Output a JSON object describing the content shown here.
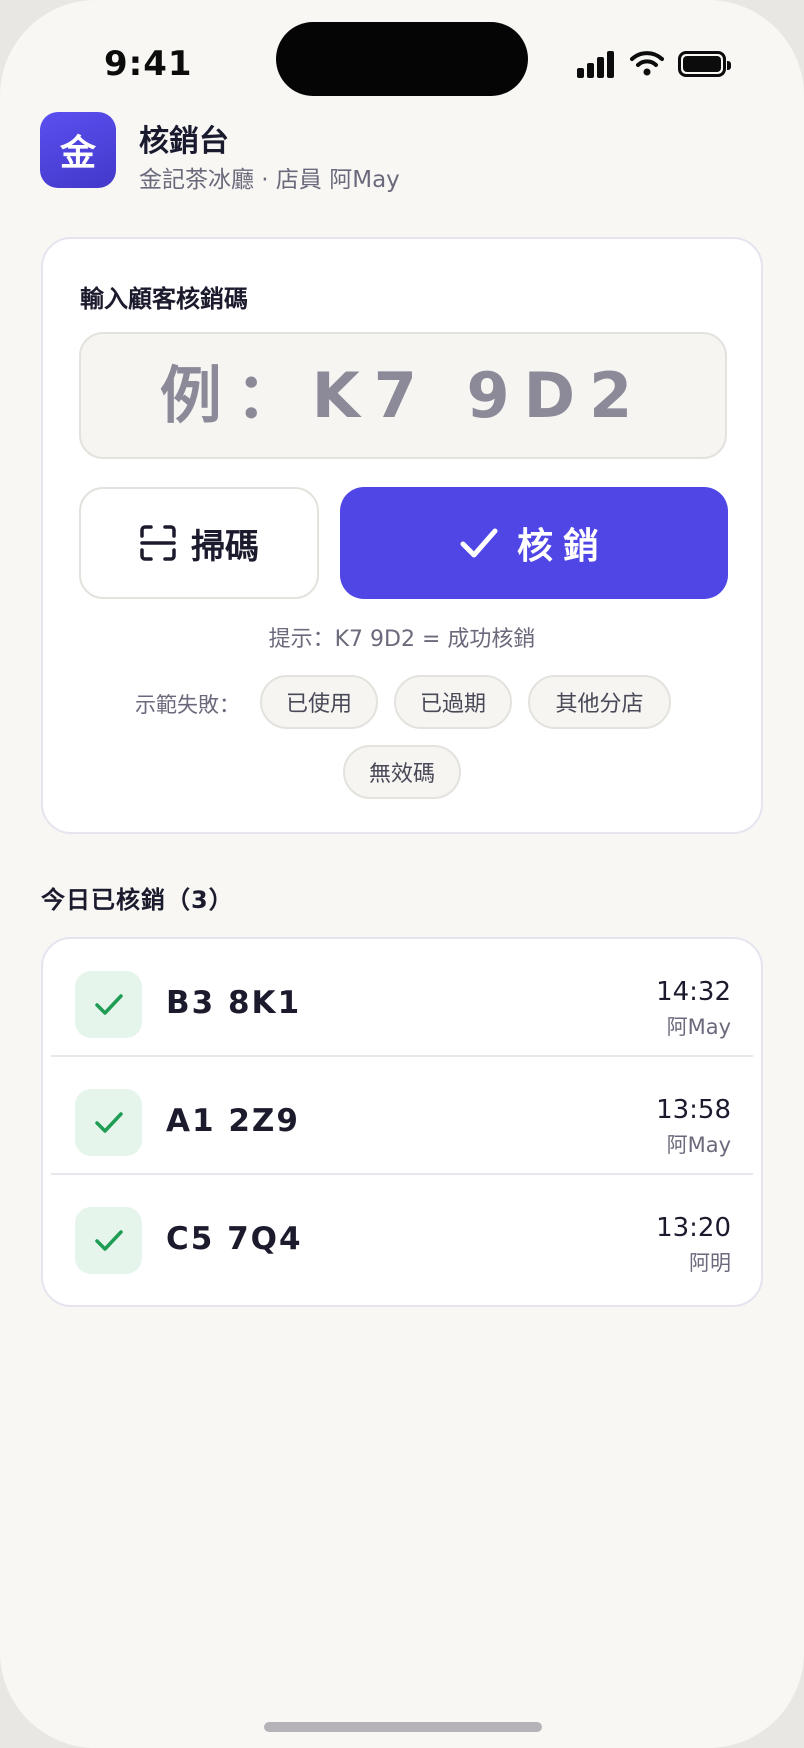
{
  "status_bar": {
    "time": "9:41"
  },
  "header": {
    "logo_char": "金",
    "title": "核銷台",
    "subtitle": "金記茶冰廳 · 店員 阿May"
  },
  "redeem": {
    "label": "輸入顧客核銷碼",
    "placeholder": "例：K7 9D2",
    "value": "",
    "scan_label": "掃碼",
    "verify_label": "核銷",
    "hint": "提示：K7 9D2 = 成功核銷",
    "demo_label": "示範失敗：",
    "demo_chips": [
      "已使用",
      "已過期",
      "其他分店",
      "無效碼"
    ]
  },
  "history": {
    "title": "今日已核銷（3）",
    "items": [
      {
        "code": "B3 8K1",
        "time": "14:32",
        "staff": "阿May"
      },
      {
        "code": "A1 2Z9",
        "time": "13:58",
        "staff": "阿May"
      },
      {
        "code": "C5 7Q4",
        "time": "13:20",
        "staff": "阿明"
      }
    ]
  },
  "colors": {
    "accent": "#4f46e5",
    "success": "#1f9d55",
    "success_bg": "#e6f5ec",
    "background": "#f8f7f4"
  },
  "icons": {
    "scan": "scan-frame-icon",
    "verify": "checkmark-icon",
    "row_status": "check-icon"
  }
}
